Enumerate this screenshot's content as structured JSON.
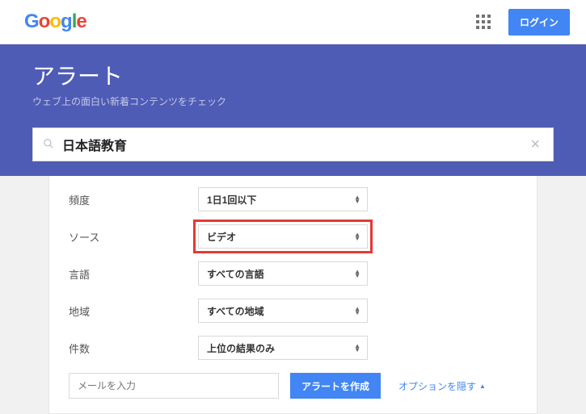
{
  "header": {
    "login_label": "ログイン"
  },
  "hero": {
    "title": "アラート",
    "subtitle": "ウェブ上の面白い新着コンテンツをチェック"
  },
  "search": {
    "value": "日本語教育"
  },
  "options": {
    "rows": [
      {
        "label": "頻度",
        "value": "1日1回以下",
        "highlight": false
      },
      {
        "label": "ソース",
        "value": "ビデオ",
        "highlight": true
      },
      {
        "label": "言語",
        "value": "すべての言語",
        "highlight": false
      },
      {
        "label": "地域",
        "value": "すべての地域",
        "highlight": false
      },
      {
        "label": "件数",
        "value": "上位の結果のみ",
        "highlight": false
      }
    ]
  },
  "footer": {
    "email_placeholder": "メールを入力",
    "create_label": "アラートを作成",
    "hide_label": "オプションを隠す"
  }
}
